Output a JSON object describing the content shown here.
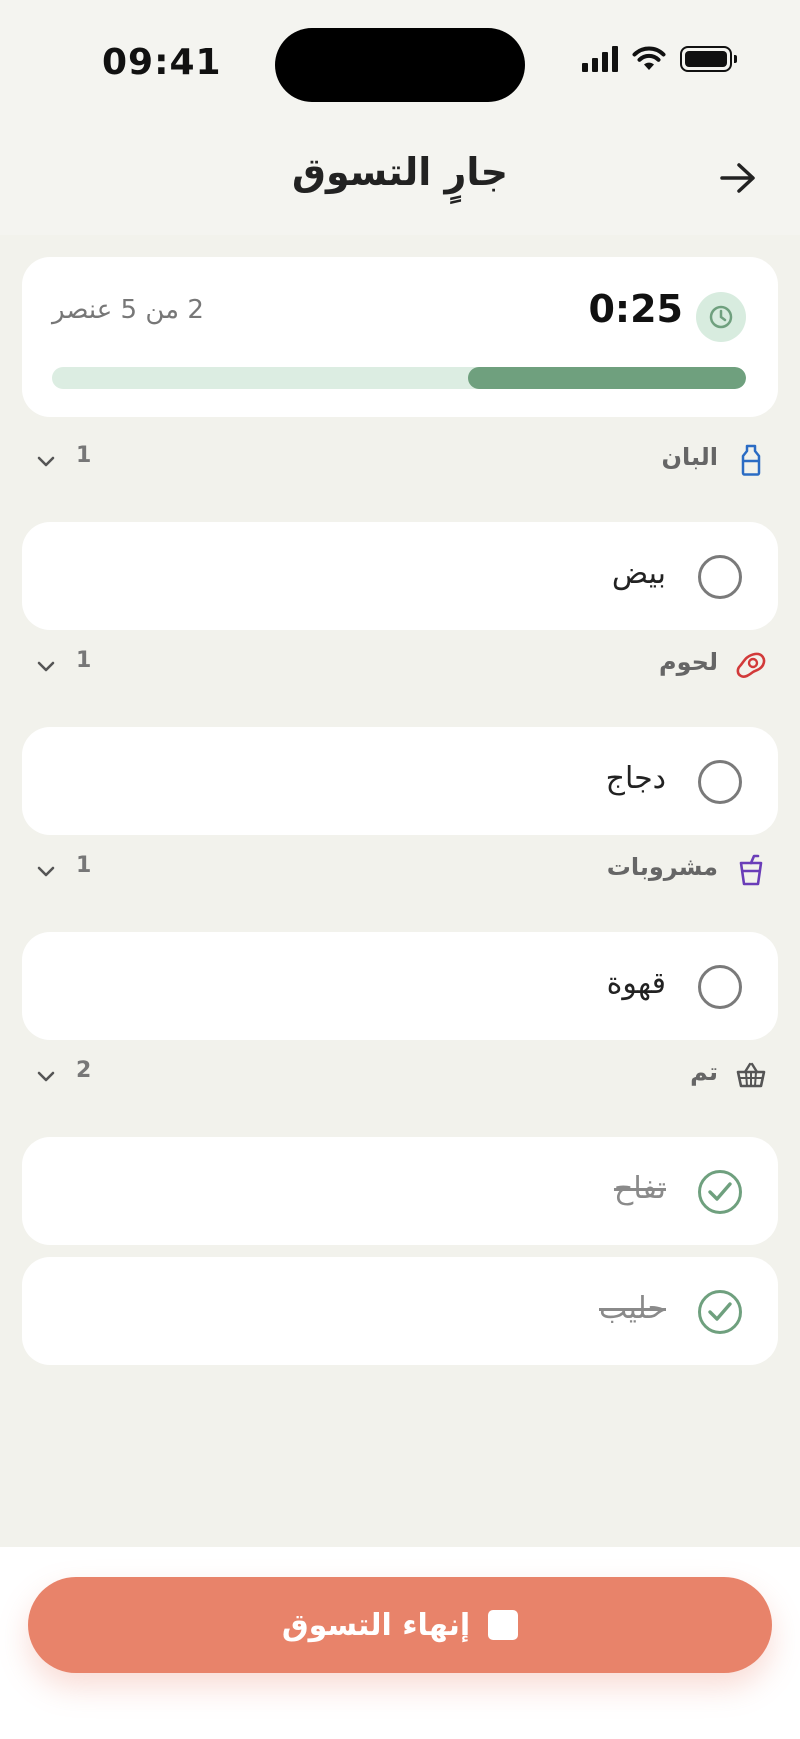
{
  "status_bar": {
    "time": "09:41"
  },
  "header": {
    "title": "جارٍ التسوق",
    "back_icon": "arrow-right-icon"
  },
  "timer": {
    "elapsed": "0:25",
    "progress_text": "2 من 5 عنصر",
    "progress_fraction": 0.4,
    "icon": "clock-icon"
  },
  "sections": [
    {
      "title": "البان",
      "count": "1",
      "icon": "milk-bottle-icon",
      "icon_color": "#2b6cc4",
      "items": [
        {
          "label": "بيض",
          "done": false
        }
      ]
    },
    {
      "title": "لحوم",
      "count": "1",
      "icon": "meat-icon",
      "icon_color": "#d23a3a",
      "items": [
        {
          "label": "دجاج",
          "done": false
        }
      ]
    },
    {
      "title": "مشروبات",
      "count": "1",
      "icon": "drink-cup-icon",
      "icon_color": "#6a3db8",
      "items": [
        {
          "label": "قهوة",
          "done": false
        }
      ]
    },
    {
      "title": "تم",
      "count": "2",
      "icon": "basket-icon",
      "icon_color": "#555555",
      "items": [
        {
          "label": "تفاح",
          "done": true
        },
        {
          "label": "حليب",
          "done": true
        }
      ]
    }
  ],
  "bottom": {
    "finish_label": "إنهاء التسوق",
    "finish_icon": "stop-icon",
    "finish_color": "#e8836a"
  },
  "colors": {
    "accent_green": "#6fa07e",
    "progress_track": "#dcede2"
  }
}
